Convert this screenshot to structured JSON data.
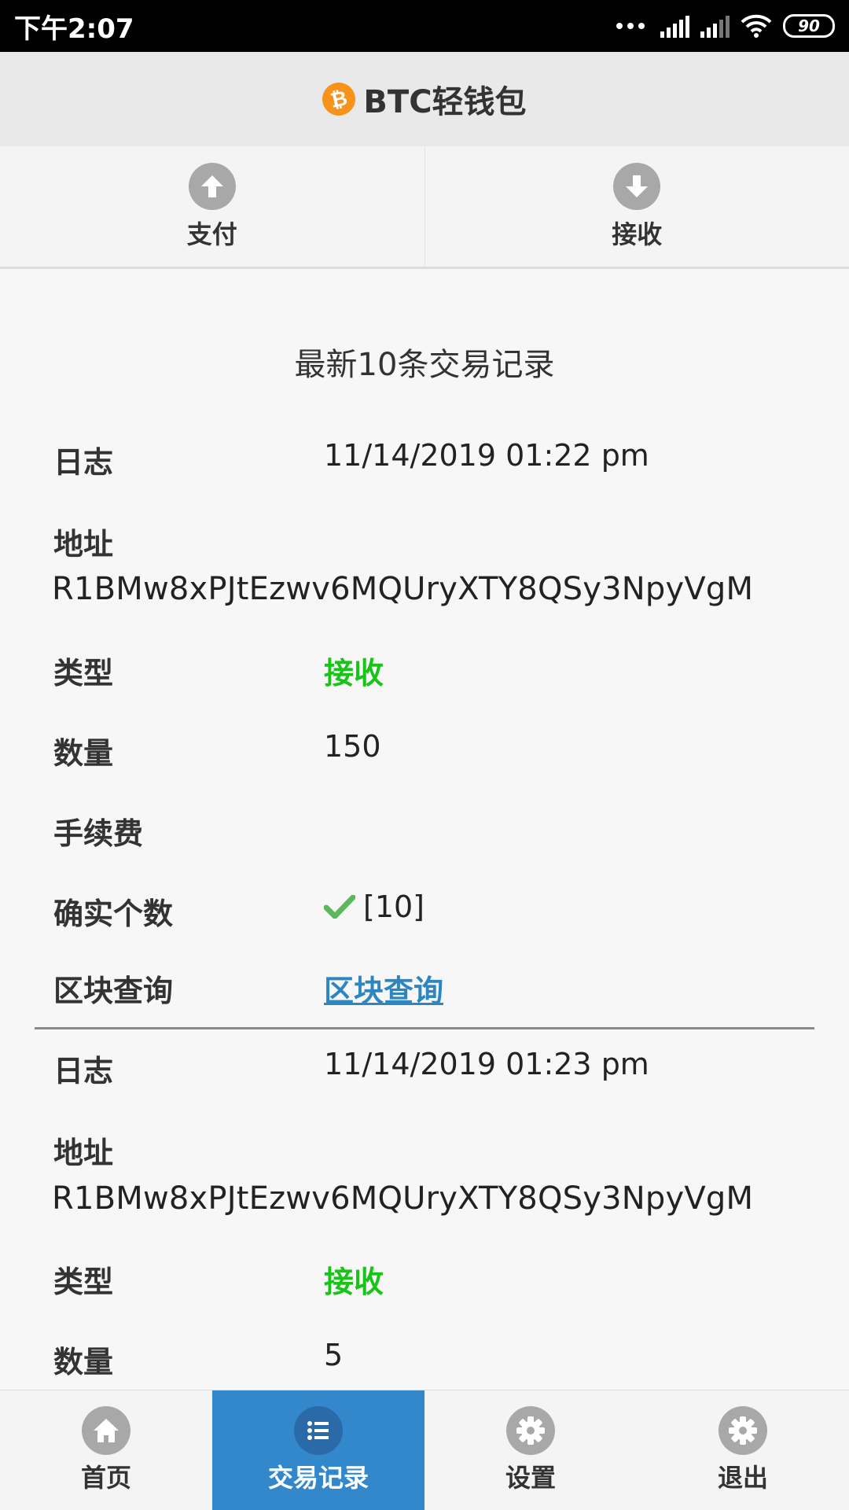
{
  "status_bar": {
    "time": "下午2:07",
    "battery": "90"
  },
  "header": {
    "logo_icon": "bitcoin-logo-icon",
    "title": "BTC轻钱包"
  },
  "actions": [
    {
      "label": "支付",
      "icon": "arrow-up-icon"
    },
    {
      "label": "接收",
      "icon": "arrow-down-icon"
    }
  ],
  "section_title": "最新10条交易记录",
  "colors": {
    "receive_green": "#18c418",
    "link_blue": "#2e86c1",
    "nav_active": "#3388cc"
  },
  "transactions": [
    {
      "log_label": "日志",
      "log_value": "11/14/2019 01:22 pm",
      "address_label": "地址",
      "address_value": "R1BMw8xPJtEzwv6MQUryXTY8QSy3NpyVgM",
      "type_label": "类型",
      "type_value": "接收",
      "amount_label": "数量",
      "amount_value": "150",
      "fee_label": "手续费",
      "fee_value": "",
      "confirm_label": "确实个数",
      "confirm_value": "[10]",
      "block_label": "区块查询",
      "block_link": "区块查询"
    },
    {
      "log_label": "日志",
      "log_value": "11/14/2019 01:23 pm",
      "address_label": "地址",
      "address_value": "R1BMw8xPJtEzwv6MQUryXTY8QSy3NpyVgM",
      "type_label": "类型",
      "type_value": "接收",
      "amount_label": "数量",
      "amount_value": "5"
    }
  ],
  "bottom_nav": [
    {
      "label": "首页",
      "icon": "home-icon",
      "active": false
    },
    {
      "label": "交易记录",
      "icon": "list-icon",
      "active": true
    },
    {
      "label": "设置",
      "icon": "gear-icon",
      "active": false
    },
    {
      "label": "退出",
      "icon": "gear-icon",
      "active": false
    }
  ]
}
